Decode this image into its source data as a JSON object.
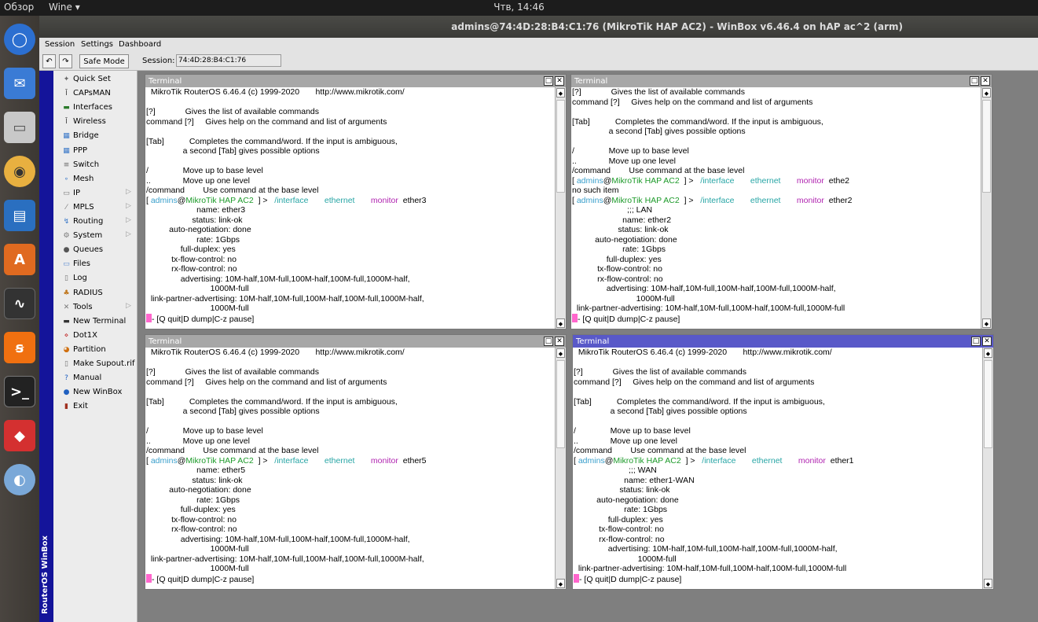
{
  "os": {
    "overview": "Обзор",
    "app_menu": "Wine ▾",
    "clock": "Чтв, 14:46"
  },
  "window": {
    "title": "admins@74:4D:28:B4:C1:76 (MikroTik HAP AC2) - WinBox v6.46.4 on hAP ac^2 (arm)"
  },
  "menu": {
    "session": "Session",
    "settings": "Settings",
    "dashboard": "Dashboard"
  },
  "toolbar": {
    "undo": "↶",
    "redo": "↷",
    "safe_mode": "Safe Mode",
    "session_label": "Session:",
    "session_value": "74:4D:28:B4:C1:76"
  },
  "vertical_label": "RouterOS WinBox",
  "sidebar": [
    {
      "label": "Quick Set",
      "icon": "quick-set-icon",
      "glyph": "✦",
      "color": "#6a6a6a",
      "arrow": false
    },
    {
      "label": "CAPsMAN",
      "icon": "capsman-icon",
      "glyph": "Ī",
      "color": "#444",
      "arrow": false
    },
    {
      "label": "Interfaces",
      "icon": "interfaces-icon",
      "glyph": "▬",
      "color": "#2a7a2a",
      "arrow": false
    },
    {
      "label": "Wireless",
      "icon": "wireless-icon",
      "glyph": "Ī",
      "color": "#444",
      "arrow": false
    },
    {
      "label": "Bridge",
      "icon": "bridge-icon",
      "glyph": "▦",
      "color": "#3a78c8",
      "arrow": false
    },
    {
      "label": "PPP",
      "icon": "ppp-icon",
      "glyph": "▦",
      "color": "#3a78c8",
      "arrow": false
    },
    {
      "label": "Switch",
      "icon": "switch-icon",
      "glyph": "≡",
      "color": "#666",
      "arrow": false
    },
    {
      "label": "Mesh",
      "icon": "mesh-icon",
      "glyph": "∘",
      "color": "#3a78c8",
      "arrow": false
    },
    {
      "label": "IP",
      "icon": "ip-icon",
      "glyph": "▭",
      "color": "#777",
      "arrow": true
    },
    {
      "label": "MPLS",
      "icon": "mpls-icon",
      "glyph": "⁄",
      "color": "#777",
      "arrow": true
    },
    {
      "label": "Routing",
      "icon": "routing-icon",
      "glyph": "↯",
      "color": "#3a78c8",
      "arrow": true
    },
    {
      "label": "System",
      "icon": "system-icon",
      "glyph": "⚙",
      "color": "#777",
      "arrow": true
    },
    {
      "label": "Queues",
      "icon": "queues-icon",
      "glyph": "●",
      "color": "#555",
      "arrow": false
    },
    {
      "label": "Files",
      "icon": "files-icon",
      "glyph": "▭",
      "color": "#5a8ad0",
      "arrow": false
    },
    {
      "label": "Log",
      "icon": "log-icon",
      "glyph": "▯",
      "color": "#777",
      "arrow": false
    },
    {
      "label": "RADIUS",
      "icon": "radius-icon",
      "glyph": "♣",
      "color": "#c07820",
      "arrow": false
    },
    {
      "label": "Tools",
      "icon": "tools-icon",
      "glyph": "✕",
      "color": "#777",
      "arrow": true
    },
    {
      "label": "New Terminal",
      "icon": "terminal-icon",
      "glyph": "▬",
      "color": "#333",
      "arrow": false
    },
    {
      "label": "Dot1X",
      "icon": "dot1x-icon",
      "glyph": "⋄",
      "color": "#c02020",
      "arrow": false
    },
    {
      "label": "Partition",
      "icon": "partition-icon",
      "glyph": "◕",
      "color": "#d07010",
      "arrow": false
    },
    {
      "label": "Make Supout.rif",
      "icon": "supout-icon",
      "glyph": "▯",
      "color": "#777",
      "arrow": false
    },
    {
      "label": "Manual",
      "icon": "manual-icon",
      "glyph": "?",
      "color": "#2060c0",
      "arrow": false
    },
    {
      "label": "New WinBox",
      "icon": "winbox-icon",
      "glyph": "●",
      "color": "#2060c0",
      "arrow": false
    },
    {
      "label": "Exit",
      "icon": "exit-icon",
      "glyph": "▮",
      "color": "#a03020",
      "arrow": false
    }
  ],
  "terminals": [
    {
      "title": "Terminal",
      "lines": [
        [
          {
            "t": "  MikroTik RouterOS 6.46.4 (c) 1999-2020       http://www.mikrotik.com/",
            "c": ""
          }
        ],
        [
          {
            "t": "",
            "c": ""
          }
        ],
        [
          {
            "t": "[?]             Gives the list of available commands",
            "c": ""
          }
        ],
        [
          {
            "t": "command [?]     Gives help on the command and list of arguments",
            "c": ""
          }
        ],
        [
          {
            "t": "",
            "c": ""
          }
        ],
        [
          {
            "t": "[Tab]           Completes the command/word. If the input is ambiguous,",
            "c": ""
          }
        ],
        [
          {
            "t": "                a second [Tab] gives possible options",
            "c": ""
          }
        ],
        [
          {
            "t": "",
            "c": ""
          }
        ],
        [
          {
            "t": "/               Move up to base level",
            "c": ""
          }
        ],
        [
          {
            "t": "..              Move up one level",
            "c": ""
          }
        ],
        [
          {
            "t": "/command        Use command at the base level",
            "c": ""
          }
        ],
        [
          {
            "t": "[ ",
            "c": ""
          },
          {
            "t": "admins",
            "c": "c-b"
          },
          {
            "t": "@",
            "c": ""
          },
          {
            "t": "MikroTik HAP AC2",
            "c": "c-g"
          },
          {
            "t": "  ] >   ",
            "c": ""
          },
          {
            "t": "/interface",
            "c": "c-t"
          },
          {
            "t": "       ethernet",
            "c": "c-t"
          },
          {
            "t": "       monitor",
            "c": "c-p"
          },
          {
            "t": "  ether3",
            "c": ""
          }
        ],
        [
          {
            "t": "                      name: ether3",
            "c": ""
          }
        ],
        [
          {
            "t": "                    status: link-ok",
            "c": ""
          }
        ],
        [
          {
            "t": "          auto-negotiation: done",
            "c": ""
          }
        ],
        [
          {
            "t": "                      rate: 1Gbps",
            "c": ""
          }
        ],
        [
          {
            "t": "               full-duplex: yes",
            "c": ""
          }
        ],
        [
          {
            "t": "           tx-flow-control: no",
            "c": ""
          }
        ],
        [
          {
            "t": "           rx-flow-control: no",
            "c": ""
          }
        ],
        [
          {
            "t": "               advertising: 10M-half,10M-full,100M-half,100M-full,1000M-half,",
            "c": ""
          }
        ],
        [
          {
            "t": "                            1000M-full",
            "c": ""
          }
        ],
        [
          {
            "t": "  link-partner-advertising: 10M-half,10M-full,100M-half,100M-full,1000M-half,",
            "c": ""
          }
        ],
        [
          {
            "t": "                            1000M-full",
            "c": ""
          }
        ],
        [
          {
            "t": "PINK",
            "c": "pink"
          },
          {
            "t": "- [Q quit|D dump|C-z pause]",
            "c": ""
          }
        ]
      ]
    },
    {
      "title": "Terminal",
      "lines": [
        [
          {
            "t": "[?]             Gives the list of available commands",
            "c": ""
          }
        ],
        [
          {
            "t": "command [?]     Gives help on the command and list of arguments",
            "c": ""
          }
        ],
        [
          {
            "t": "",
            "c": ""
          }
        ],
        [
          {
            "t": "[Tab]           Completes the command/word. If the input is ambiguous,",
            "c": ""
          }
        ],
        [
          {
            "t": "                a second [Tab] gives possible options",
            "c": ""
          }
        ],
        [
          {
            "t": "",
            "c": ""
          }
        ],
        [
          {
            "t": "/               Move up to base level",
            "c": ""
          }
        ],
        [
          {
            "t": "..              Move up one level",
            "c": ""
          }
        ],
        [
          {
            "t": "/command        Use command at the base level",
            "c": ""
          }
        ],
        [
          {
            "t": "[ ",
            "c": ""
          },
          {
            "t": "admins",
            "c": "c-b"
          },
          {
            "t": "@",
            "c": ""
          },
          {
            "t": "MikroTik HAP AC2",
            "c": "c-g"
          },
          {
            "t": "  ] >   ",
            "c": ""
          },
          {
            "t": "/interface",
            "c": "c-t"
          },
          {
            "t": "       ethernet",
            "c": "c-t"
          },
          {
            "t": "       monitor",
            "c": "c-p"
          },
          {
            "t": "  ethe2",
            "c": ""
          }
        ],
        [
          {
            "t": "no such item",
            "c": ""
          }
        ],
        [
          {
            "t": "[ ",
            "c": ""
          },
          {
            "t": "admins",
            "c": "c-b"
          },
          {
            "t": "@",
            "c": ""
          },
          {
            "t": "MikroTik HAP AC2",
            "c": "c-g"
          },
          {
            "t": "  ] >   ",
            "c": ""
          },
          {
            "t": "/interface",
            "c": "c-t"
          },
          {
            "t": "       ethernet",
            "c": "c-t"
          },
          {
            "t": "       monitor",
            "c": "c-p"
          },
          {
            "t": "  ether2",
            "c": ""
          }
        ],
        [
          {
            "t": "                        ;;; LAN",
            "c": ""
          }
        ],
        [
          {
            "t": "                      name: ether2",
            "c": ""
          }
        ],
        [
          {
            "t": "                    status: link-ok",
            "c": ""
          }
        ],
        [
          {
            "t": "          auto-negotiation: done",
            "c": ""
          }
        ],
        [
          {
            "t": "                      rate: 1Gbps",
            "c": ""
          }
        ],
        [
          {
            "t": "               full-duplex: yes",
            "c": ""
          }
        ],
        [
          {
            "t": "           tx-flow-control: no",
            "c": ""
          }
        ],
        [
          {
            "t": "           rx-flow-control: no",
            "c": ""
          }
        ],
        [
          {
            "t": "               advertising: 10M-half,10M-full,100M-half,100M-full,1000M-half,",
            "c": ""
          }
        ],
        [
          {
            "t": "                            1000M-full",
            "c": ""
          }
        ],
        [
          {
            "t": "  link-partner-advertising: 10M-half,10M-full,100M-half,100M-full,1000M-full",
            "c": ""
          }
        ],
        [
          {
            "t": "PINK",
            "c": "pink"
          },
          {
            "t": "- [Q quit|D dump|C-z pause]",
            "c": ""
          }
        ]
      ]
    },
    {
      "title": "Terminal",
      "lines": [
        [
          {
            "t": "  MikroTik RouterOS 6.46.4 (c) 1999-2020       http://www.mikrotik.com/",
            "c": ""
          }
        ],
        [
          {
            "t": "",
            "c": ""
          }
        ],
        [
          {
            "t": "[?]             Gives the list of available commands",
            "c": ""
          }
        ],
        [
          {
            "t": "command [?]     Gives help on the command and list of arguments",
            "c": ""
          }
        ],
        [
          {
            "t": "",
            "c": ""
          }
        ],
        [
          {
            "t": "[Tab]           Completes the command/word. If the input is ambiguous,",
            "c": ""
          }
        ],
        [
          {
            "t": "                a second [Tab] gives possible options",
            "c": ""
          }
        ],
        [
          {
            "t": "",
            "c": ""
          }
        ],
        [
          {
            "t": "/               Move up to base level",
            "c": ""
          }
        ],
        [
          {
            "t": "..              Move up one level",
            "c": ""
          }
        ],
        [
          {
            "t": "/command        Use command at the base level",
            "c": ""
          }
        ],
        [
          {
            "t": "[ ",
            "c": ""
          },
          {
            "t": "admins",
            "c": "c-b"
          },
          {
            "t": "@",
            "c": ""
          },
          {
            "t": "MikroTik HAP AC2",
            "c": "c-g"
          },
          {
            "t": "  ] >   ",
            "c": ""
          },
          {
            "t": "/interface",
            "c": "c-t"
          },
          {
            "t": "       ethernet",
            "c": "c-t"
          },
          {
            "t": "       monitor",
            "c": "c-p"
          },
          {
            "t": "  ether5",
            "c": ""
          }
        ],
        [
          {
            "t": "                      name: ether5",
            "c": ""
          }
        ],
        [
          {
            "t": "                    status: link-ok",
            "c": ""
          }
        ],
        [
          {
            "t": "          auto-negotiation: done",
            "c": ""
          }
        ],
        [
          {
            "t": "                      rate: 1Gbps",
            "c": ""
          }
        ],
        [
          {
            "t": "               full-duplex: yes",
            "c": ""
          }
        ],
        [
          {
            "t": "           tx-flow-control: no",
            "c": ""
          }
        ],
        [
          {
            "t": "           rx-flow-control: no",
            "c": ""
          }
        ],
        [
          {
            "t": "               advertising: 10M-half,10M-full,100M-half,100M-full,1000M-half,",
            "c": ""
          }
        ],
        [
          {
            "t": "                            1000M-full",
            "c": ""
          }
        ],
        [
          {
            "t": "  link-partner-advertising: 10M-half,10M-full,100M-half,100M-full,1000M-half,",
            "c": ""
          }
        ],
        [
          {
            "t": "                            1000M-full",
            "c": ""
          }
        ],
        [
          {
            "t": "PINK",
            "c": "pink"
          },
          {
            "t": "- [Q quit|D dump|C-z pause]",
            "c": ""
          }
        ]
      ]
    },
    {
      "title": "Terminal",
      "lines": [
        [
          {
            "t": "  MikroTik RouterOS 6.46.4 (c) 1999-2020       http://www.mikrotik.com/",
            "c": ""
          }
        ],
        [
          {
            "t": "",
            "c": ""
          }
        ],
        [
          {
            "t": "[?]             Gives the list of available commands",
            "c": ""
          }
        ],
        [
          {
            "t": "command [?]     Gives help on the command and list of arguments",
            "c": ""
          }
        ],
        [
          {
            "t": "",
            "c": ""
          }
        ],
        [
          {
            "t": "[Tab]           Completes the command/word. If the input is ambiguous,",
            "c": ""
          }
        ],
        [
          {
            "t": "                a second [Tab] gives possible options",
            "c": ""
          }
        ],
        [
          {
            "t": "",
            "c": ""
          }
        ],
        [
          {
            "t": "/               Move up to base level",
            "c": ""
          }
        ],
        [
          {
            "t": "..              Move up one level",
            "c": ""
          }
        ],
        [
          {
            "t": "/command        Use command at the base level",
            "c": ""
          }
        ],
        [
          {
            "t": "[ ",
            "c": ""
          },
          {
            "t": "admins",
            "c": "c-b"
          },
          {
            "t": "@",
            "c": ""
          },
          {
            "t": "MikroTik HAP AC2",
            "c": "c-g"
          },
          {
            "t": "  ] >   ",
            "c": ""
          },
          {
            "t": "/interface",
            "c": "c-t"
          },
          {
            "t": "       ethernet",
            "c": "c-t"
          },
          {
            "t": "       monitor",
            "c": "c-p"
          },
          {
            "t": "  ether1",
            "c": ""
          }
        ],
        [
          {
            "t": "                        ;;; WAN",
            "c": ""
          }
        ],
        [
          {
            "t": "                      name: ether1-WAN",
            "c": ""
          }
        ],
        [
          {
            "t": "                    status: link-ok",
            "c": ""
          }
        ],
        [
          {
            "t": "          auto-negotiation: done",
            "c": ""
          }
        ],
        [
          {
            "t": "                      rate: 1Gbps",
            "c": ""
          }
        ],
        [
          {
            "t": "               full-duplex: yes",
            "c": ""
          }
        ],
        [
          {
            "t": "           tx-flow-control: no",
            "c": ""
          }
        ],
        [
          {
            "t": "           rx-flow-control: no",
            "c": ""
          }
        ],
        [
          {
            "t": "               advertising: 10M-half,10M-full,100M-half,100M-full,1000M-half,",
            "c": ""
          }
        ],
        [
          {
            "t": "                            1000M-full",
            "c": ""
          }
        ],
        [
          {
            "t": "  link-partner-advertising: 10M-half,10M-full,100M-half,100M-full,1000M-full",
            "c": ""
          }
        ],
        [
          {
            "t": "PINK",
            "c": "pink"
          },
          {
            "t": "- [Q quit|D dump|C-z pause]",
            "c": ""
          }
        ]
      ]
    }
  ]
}
